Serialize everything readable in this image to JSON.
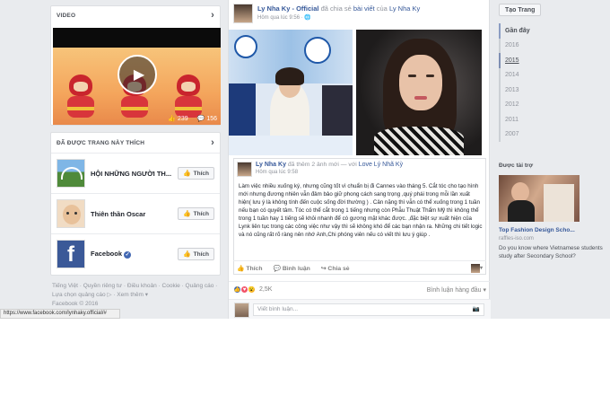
{
  "left": {
    "video_section": {
      "title": "VIDEO",
      "views": "239",
      "likes": "156"
    },
    "liked_pages": {
      "title": "ĐÃ ĐƯỢC TRANG NÀY THÍCH",
      "items": [
        {
          "name": "HỘI NHỮNG NGƯỜI TH...",
          "button": "Thích"
        },
        {
          "name": "Thiên thần Oscar",
          "button": "Thích"
        },
        {
          "name": "Facebook",
          "button": "Thích"
        }
      ]
    },
    "footer": {
      "links": [
        "Tiếng Việt",
        "Quyền riêng tư",
        "Điều khoản",
        "Cookie",
        "Quảng cáo",
        "Lựa chọn quảng cáo",
        "Xem thêm"
      ],
      "more_suffix": "▾",
      "copyright": "Facebook © 2016"
    }
  },
  "post": {
    "author": "Ly Nha Ky - Official",
    "action": "đã chia sẻ",
    "action_link": "bài viết",
    "of": "của",
    "target": "Ly Nha Ky",
    "time": "Hôm qua lúc 9:56",
    "time_suffix": "·",
    "shared": {
      "author": "Ly Nha Ky",
      "action": "đã thêm 2 ảnh mới — với",
      "with": "Love Lý Nhã Kỳ",
      "time": "Hôm qua lúc 9:58",
      "text": "Làm việc nhiều xuống ký, nhưng cũng tốt vì chuẩn bị đi Cannes vào tháng 5. Cắt tóc cho tạo hình mới nhưng đương nhiên vẫn đảm bảo giữ phong cách sang trọng ,quý phái trong mỗi lần xuất hiện( lưu ý là không tính đến cuộc sống đời thường ) . Cân nặng thì vẫn có thể xuống trong 1 tuần nếu bạn có quyết tâm. Tóc có thể cắt trong 1 tiếng nhưng còn Phẫu Thuật Thẩm Mỹ thì không thể trong 1 tuần hay 1 tiếng sẽ khỏi nhanh để có gương mặt khác được. ,đặc biệt sự xuất hiện của Lynk liên tục trong các công việc như vậy thì sẽ không khó để các bạn nhận ra. Những chi tiết logic và nó cũng rất rõ ràng nên nhớ Anh,Chi phóng viên nếu có viết thì lưu ý giúp ."
    },
    "actions": {
      "like": "Thích",
      "comment": "Bình luận",
      "share": "Chia sẻ"
    },
    "reactions_count": "2,5K",
    "top_comments": "Bình luận hàng đầu",
    "comment_placeholder": "Viết bình luận..."
  },
  "right": {
    "create_page": "Tạo Trang",
    "years": [
      "Gần đây",
      "2016",
      "2015",
      "2014",
      "2013",
      "2012",
      "2011",
      "2007"
    ],
    "sponsored": "Được tài trợ",
    "ad": {
      "title": "Top Fashion Design Scho...",
      "domain": "raffles-iso.com",
      "desc": "Do you know where Vietnamese students study after Secondary School?"
    }
  },
  "status_url": "https://www.facebook.com/lynhaky.official/#",
  "colors": {
    "link": "#365899",
    "bg": "#e9ebee",
    "muted": "#90949c"
  }
}
